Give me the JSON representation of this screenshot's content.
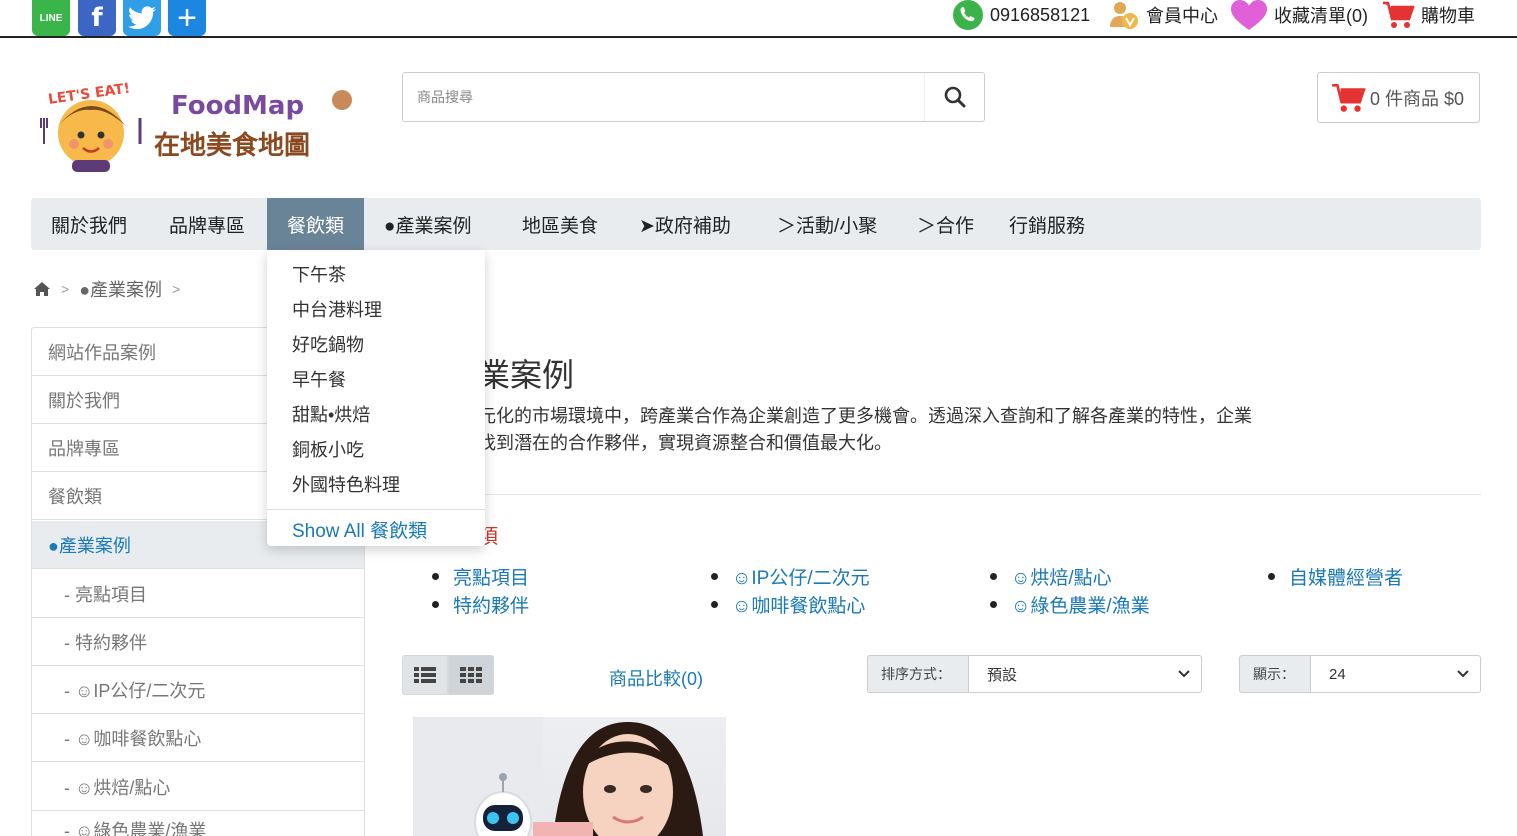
{
  "topbar": {
    "share": {
      "line": "LINE"
    },
    "phone": "0916858121",
    "member_center": "會員中心",
    "wishlist": "收藏清單(0)",
    "cart": "購物車"
  },
  "logo": {
    "lets_eat": "LET'S EAT!",
    "foodmap": "FoodMap",
    "chinese": "在地美食地圖"
  },
  "search": {
    "placeholder": "商品搜尋"
  },
  "cart_box": {
    "label": "0 件商品 $0"
  },
  "nav": {
    "items": [
      "關於我們",
      "品牌專區",
      "餐飲類",
      "●產業案例",
      "地區美食",
      "➤政府補助",
      "＞活動/小聚",
      "＞合作",
      "行銷服務"
    ]
  },
  "dropdown": {
    "items": [
      "下午茶",
      "中台港料理",
      "好吃鍋物",
      "早午餐",
      "甜點•烘焙",
      "銅板小吃",
      "外國特色料理"
    ],
    "show_all": "Show All 餐飲類"
  },
  "breadcrumb": {
    "current": "●產業案例"
  },
  "sidebar": {
    "items": [
      "網站作品案例",
      "關於我們",
      "品牌專區",
      "餐飲類",
      "●產業案例",
      "- 亮點項目",
      "- 特約夥伴",
      "- ☺IP公仔/二次元",
      "- ☺咖啡餐飲點心",
      "- ☺烘焙/點心",
      "- ☺綠色農業/漁業"
    ]
  },
  "content": {
    "title": "業案例",
    "desc_line1": "元化的市場環境中，跨產業合作為企業創造了更多機會。透過深入查詢和了解各產業的特性，企業",
    "desc_line2": "找到潛在的合作夥伴，實現資源整合和價值最大化。",
    "subhead": "項",
    "categories": [
      "亮點項目",
      "特約夥伴",
      "☺IP公仔/二次元",
      "☺咖啡餐飲點心",
      "☺烘焙/點心",
      "☺綠色農業/漁業",
      "自媒體經營者"
    ]
  },
  "toolbar": {
    "compare": "商品比較(0)",
    "sort_label": "排序方式：",
    "sort_value": "預設",
    "show_label": "顯示：",
    "show_value": "24"
  },
  "colors": {
    "link": "#1a7ab5",
    "nav_active": "#6a8497",
    "nav_bg": "#e8ecef",
    "accent_red": "#c43c2d"
  }
}
